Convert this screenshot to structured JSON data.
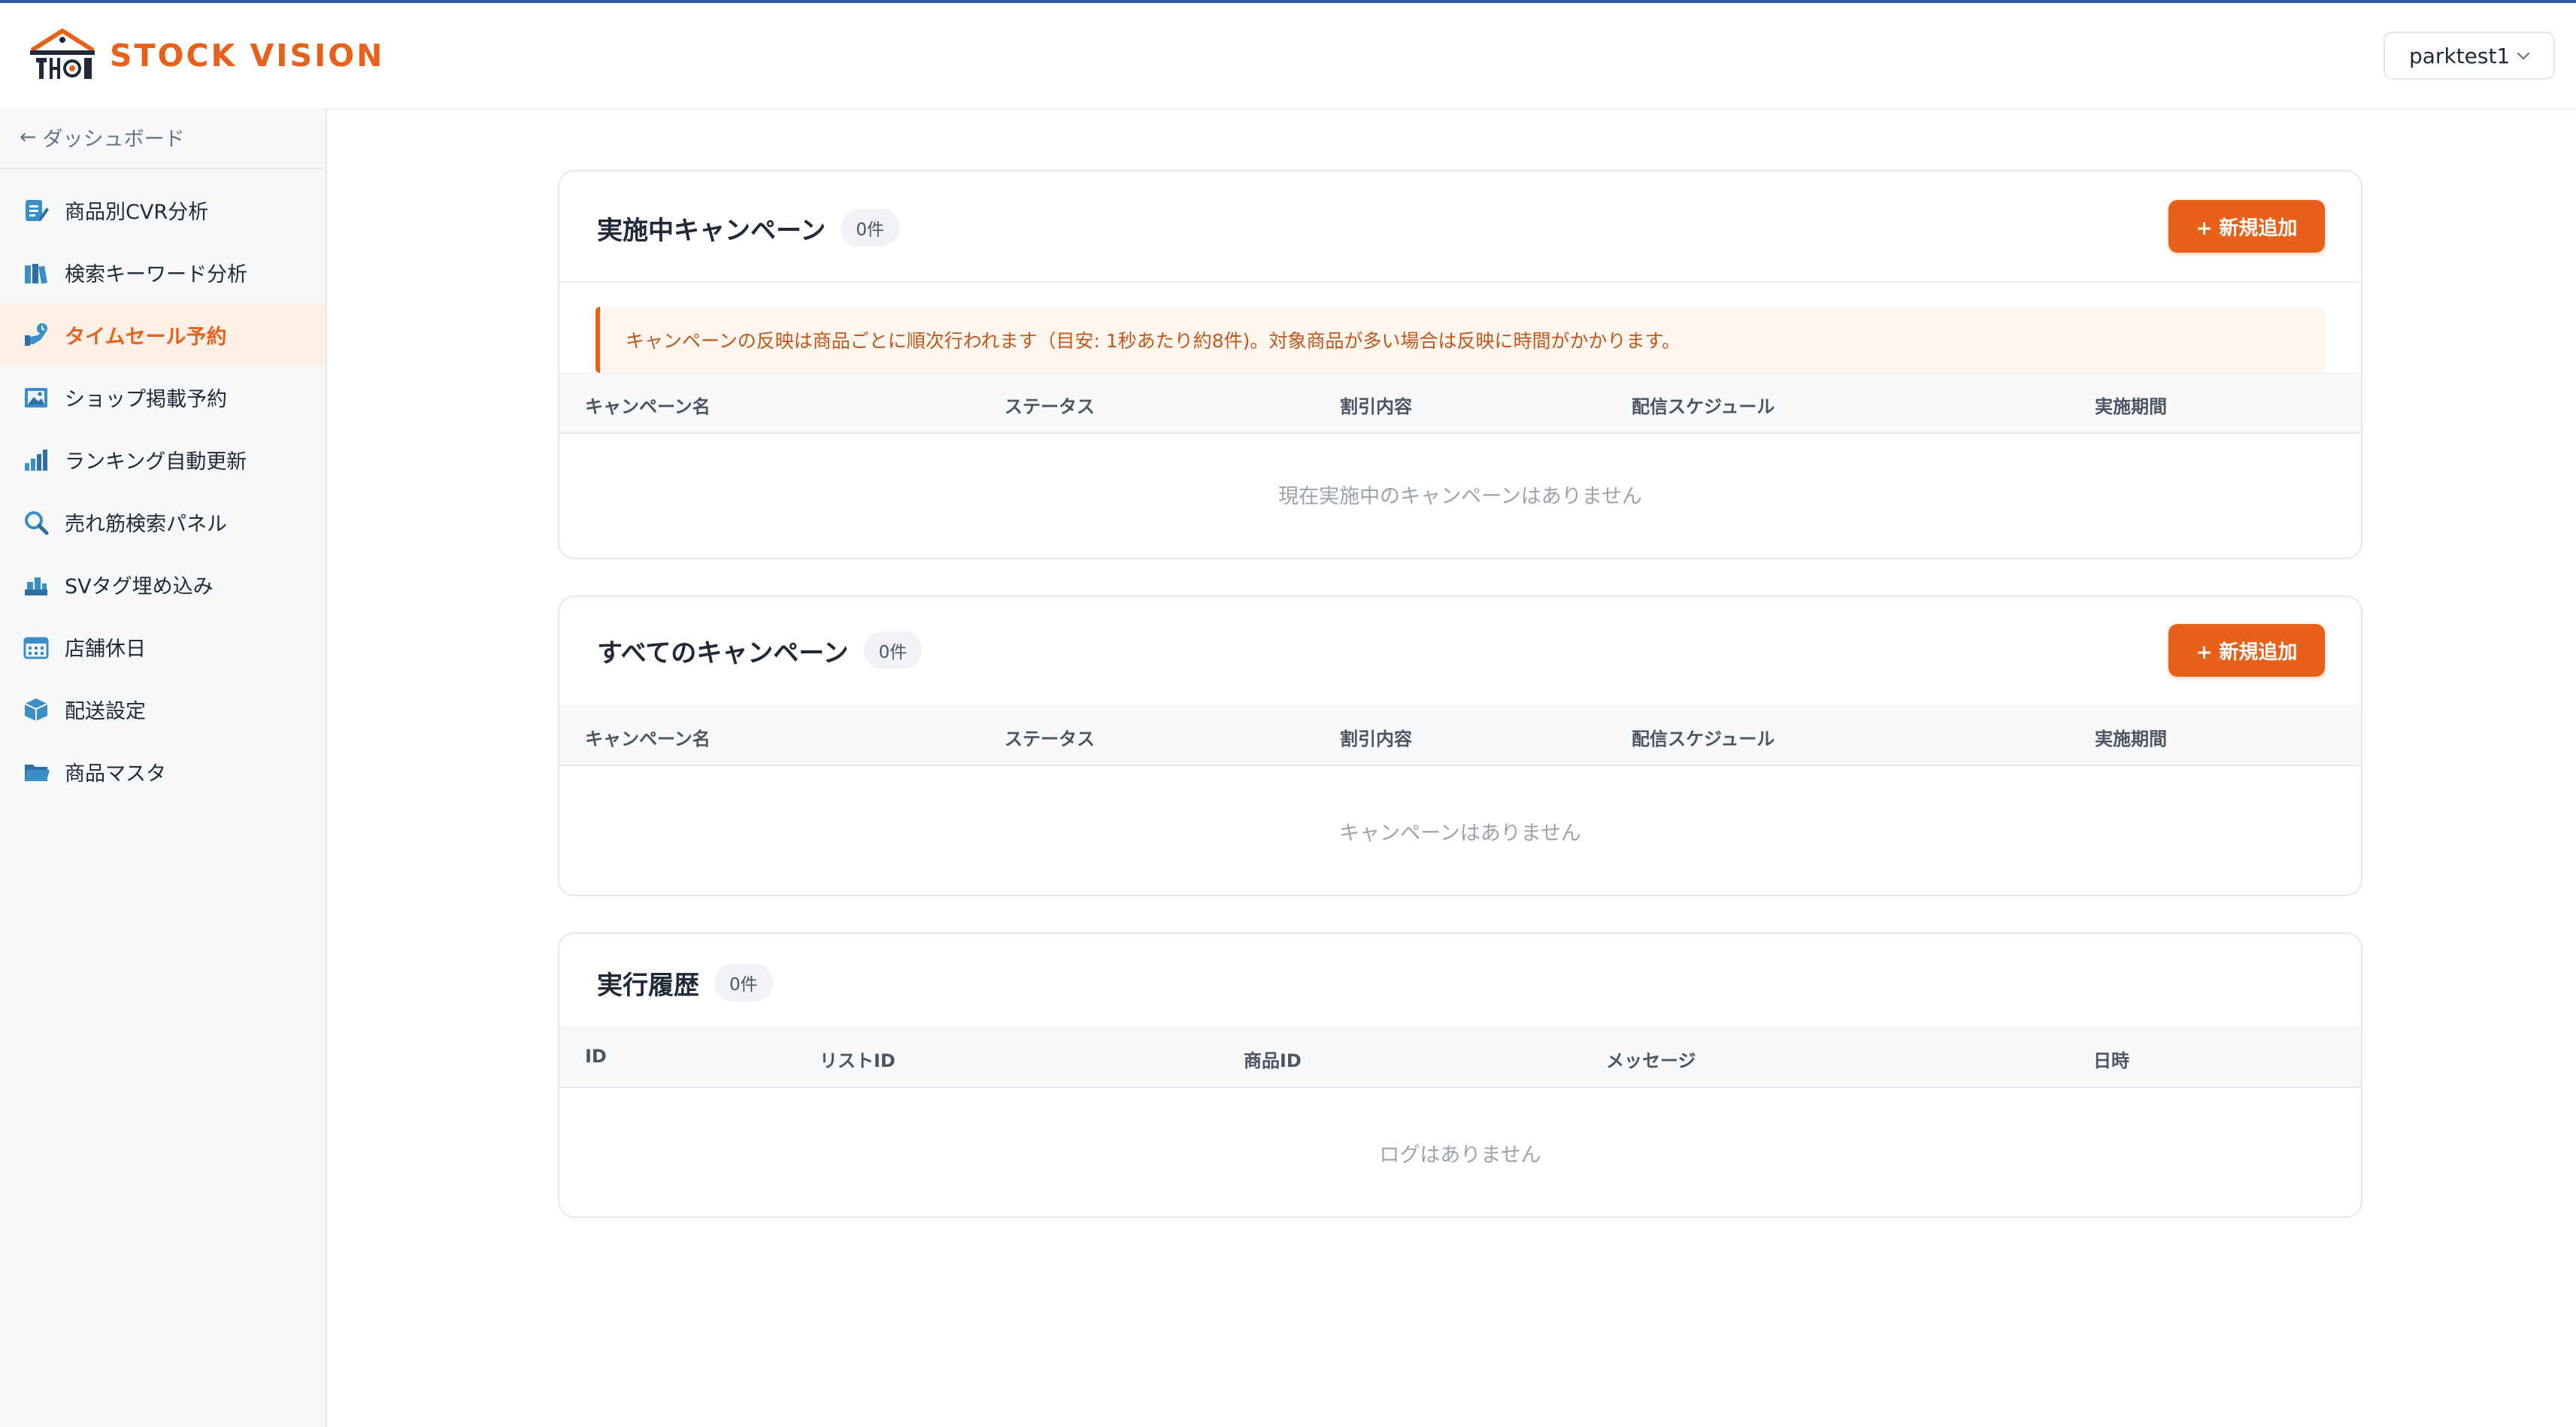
{
  "app": {
    "brand": "STOCK VISION",
    "user": "parktest1"
  },
  "sidebar": {
    "back_label": "ダッシュボード",
    "items": [
      {
        "label": "商品別CVR分析",
        "icon": "edit-document-icon"
      },
      {
        "label": "検索キーワード分析",
        "icon": "books-icon"
      },
      {
        "label": "タイムセール予約",
        "icon": "hand-timer-icon",
        "active": true
      },
      {
        "label": "ショップ掲載予約",
        "icon": "picture-icon"
      },
      {
        "label": "ランキング自動更新",
        "icon": "bar-chart-icon"
      },
      {
        "label": "売れ筋検索パネル",
        "icon": "search-icon"
      },
      {
        "label": "SVタグ埋め込み",
        "icon": "tag-embed-icon"
      },
      {
        "label": "店舗休日",
        "icon": "calendar-icon"
      },
      {
        "label": "配送設定",
        "icon": "box-icon"
      },
      {
        "label": "商品マスタ",
        "icon": "folder-icon"
      }
    ]
  },
  "active_campaigns": {
    "title": "実施中キャンペーン",
    "count": "0件",
    "add_label": "+ 新規追加",
    "notice": "キャンペーンの反映は商品ごとに順次行われます（目安: 1秒あたり約8件)。対象商品が多い場合は反映に時間がかかります。",
    "columns": [
      "キャンペーン名",
      "ステータス",
      "割引内容",
      "配信スケジュール",
      "実施期間"
    ],
    "empty": "現在実施中のキャンペーンはありません"
  },
  "all_campaigns": {
    "title": "すべてのキャンペーン",
    "count": "0件",
    "add_label": "+ 新規追加",
    "columns": [
      "キャンペーン名",
      "ステータス",
      "割引内容",
      "配信スケジュール",
      "実施期間"
    ],
    "empty": "キャンペーンはありません"
  },
  "history": {
    "title": "実行履歴",
    "count": "0件",
    "columns": [
      "ID",
      "リストID",
      "商品ID",
      "メッセージ",
      "日時"
    ],
    "empty": "ログはありません"
  },
  "colors": {
    "accent": "#e8611a",
    "active_bg": "#fdf0e6",
    "topline": "#2f5a9e"
  }
}
